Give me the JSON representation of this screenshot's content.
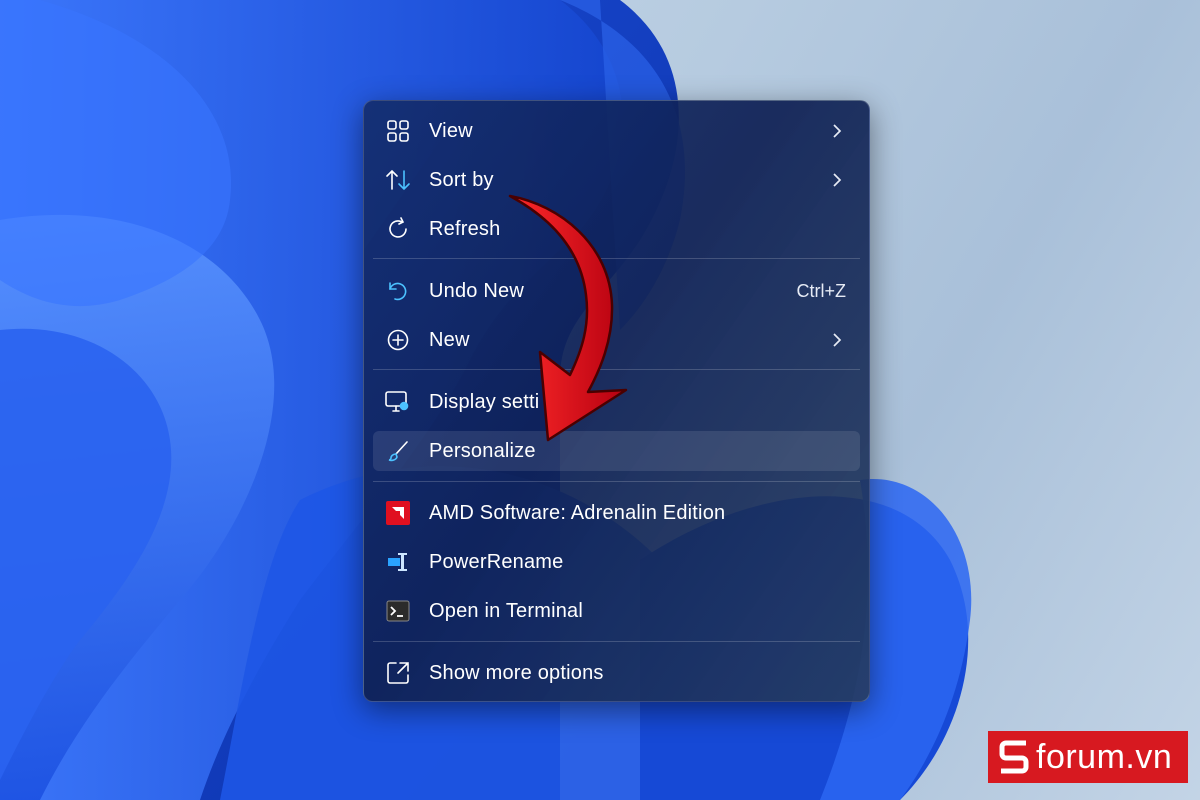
{
  "menu": {
    "items": [
      {
        "label": "View",
        "icon": "grid-icon",
        "submenu": true
      },
      {
        "label": "Sort by",
        "icon": "sort-icon",
        "submenu": true
      },
      {
        "label": "Refresh",
        "icon": "refresh-icon"
      },
      {
        "label": "Undo New",
        "icon": "undo-icon",
        "shortcut": "Ctrl+Z"
      },
      {
        "label": "New",
        "icon": "plus-circle-icon",
        "submenu": true
      },
      {
        "label": "Display setti",
        "icon": "display-settings-icon"
      },
      {
        "label": "Personalize",
        "icon": "brush-icon",
        "highlighted": true
      },
      {
        "label": "AMD Software: Adrenalin Edition",
        "icon": "amd-icon"
      },
      {
        "label": "PowerRename",
        "icon": "powerrename-icon"
      },
      {
        "label": "Open in Terminal",
        "icon": "terminal-icon"
      },
      {
        "label": "Show more options",
        "icon": "show-more-icon"
      }
    ]
  },
  "watermark": {
    "text": "forum.vn",
    "icon": "sforum-s-logo"
  },
  "colors": {
    "accent": "#4cc2ff",
    "annotation_arrow": "#e0101a",
    "brand": "#d71920"
  }
}
